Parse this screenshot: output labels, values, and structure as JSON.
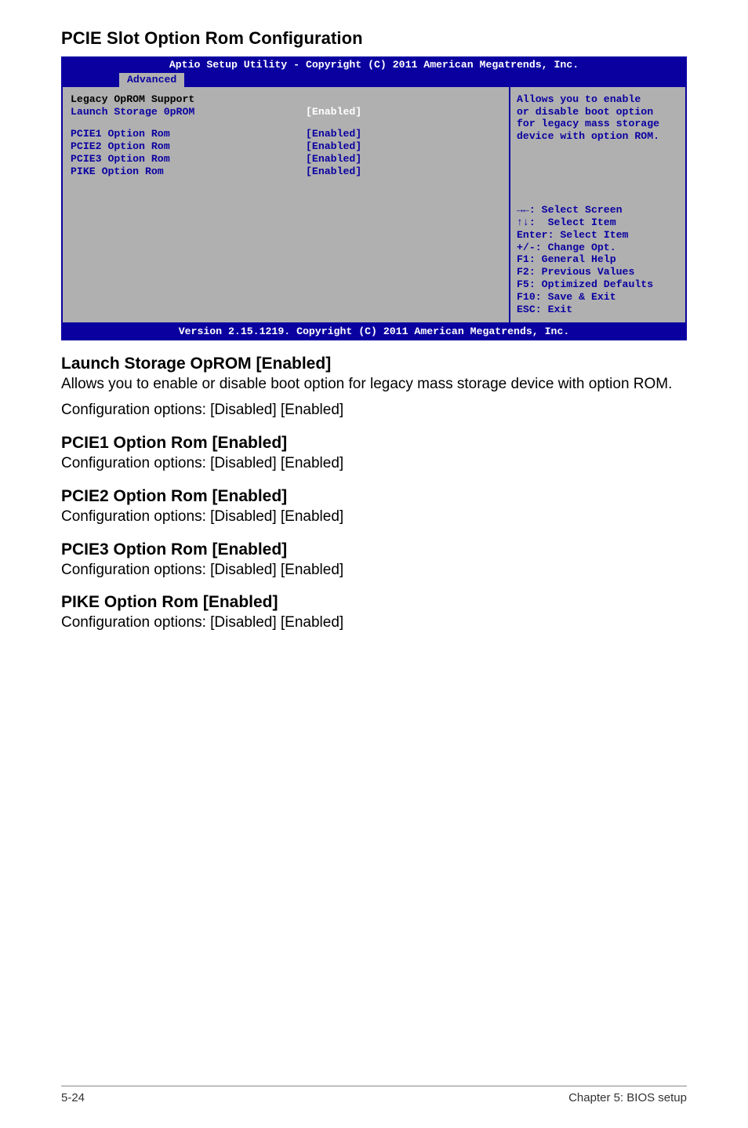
{
  "page": {
    "title": "PCIE Slot Option Rom Configuration"
  },
  "bios": {
    "header_line1": "Aptio Setup Utility - Copyright (C) 2011 American Megatrends, Inc.",
    "tab": "Advanced",
    "section_label": "Legacy OpROM Support",
    "items": [
      {
        "label": "Launch Storage 0pROM",
        "value": "[Enabled]",
        "highlight": true
      },
      {
        "label": "PCIE1 Option Rom",
        "value": "[Enabled]",
        "highlight": false
      },
      {
        "label": "PCIE2 Option Rom",
        "value": "[Enabled]",
        "highlight": false
      },
      {
        "label": "PCIE3 Option Rom",
        "value": "[Enabled]",
        "highlight": false
      },
      {
        "label": "PIKE Option Rom",
        "value": "[Enabled]",
        "highlight": false
      }
    ],
    "help": [
      "Allows you to enable",
      "or disable boot option",
      "for legacy mass storage",
      "device with option ROM."
    ],
    "legend": [
      "→←: Select Screen",
      "↑↓:  Select Item",
      "Enter: Select Item",
      "+/-: Change Opt.",
      "F1: General Help",
      "F2: Previous Values",
      "F5: Optimized Defaults",
      "F10: Save & Exit",
      "ESC: Exit"
    ],
    "footer": "Version 2.15.1219. Copyright (C) 2011 American Megatrends, Inc."
  },
  "sections": [
    {
      "heading": "Launch Storage OpROM [Enabled]",
      "body1": "Allows you to enable or disable boot option for legacy mass storage device with option ROM.",
      "body2": "Configuration options: [Disabled] [Enabled]"
    },
    {
      "heading": "PCIE1 Option Rom [Enabled]",
      "body1": "Configuration options: [Disabled] [Enabled]"
    },
    {
      "heading": "PCIE2 Option Rom [Enabled]",
      "body1": "Configuration options: [Disabled] [Enabled]"
    },
    {
      "heading": "PCIE3 Option Rom [Enabled]",
      "body1": "Configuration options: [Disabled] [Enabled]"
    },
    {
      "heading": "PIKE Option Rom [Enabled]",
      "body1": "Configuration options: [Disabled] [Enabled]"
    }
  ],
  "footer": {
    "left": "5-24",
    "right": "Chapter 5: BIOS setup"
  }
}
